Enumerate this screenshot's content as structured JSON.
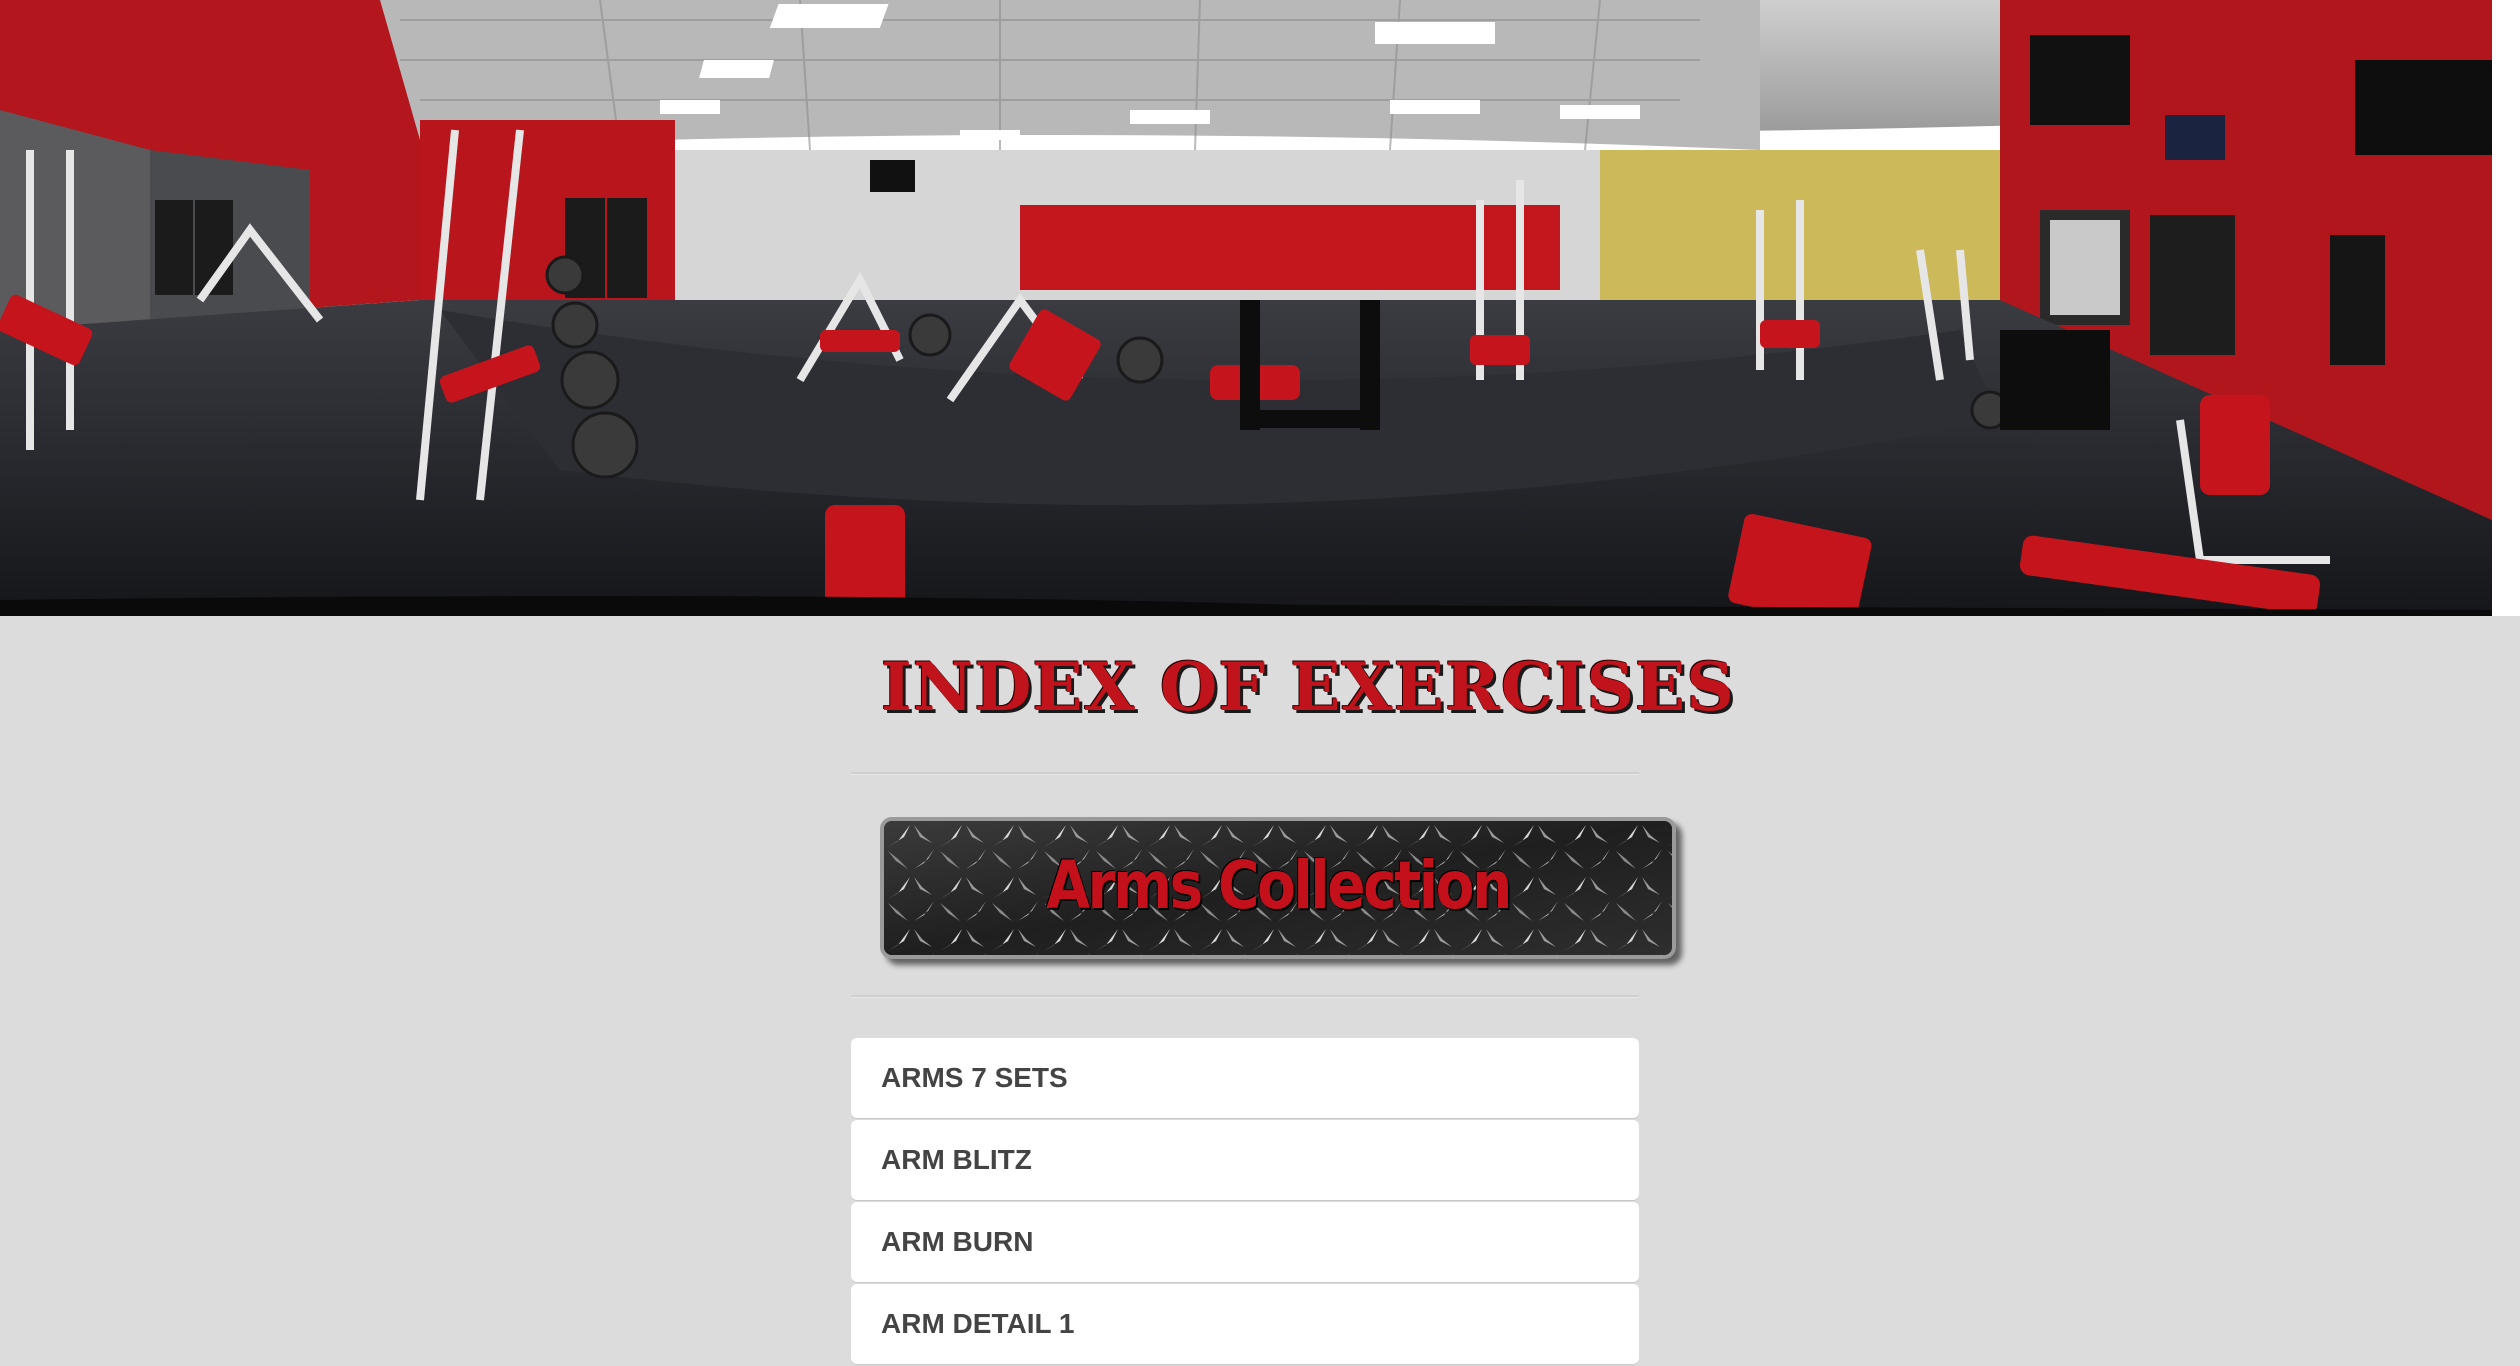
{
  "page": {
    "title": "INDEX OF EXERCISES"
  },
  "hero": {
    "image_name": "gym-panorama"
  },
  "banner": {
    "label": "Arms Collection"
  },
  "exercises": [
    {
      "label": "ARMS 7 SETS"
    },
    {
      "label": "ARM BLITZ"
    },
    {
      "label": "ARM BURN"
    },
    {
      "label": "ARM DETAIL 1"
    }
  ],
  "colors": {
    "accent_red": "#c0131b",
    "page_background": "#dcdcdc",
    "list_item_background": "#ffffff",
    "list_text": "#444444"
  }
}
